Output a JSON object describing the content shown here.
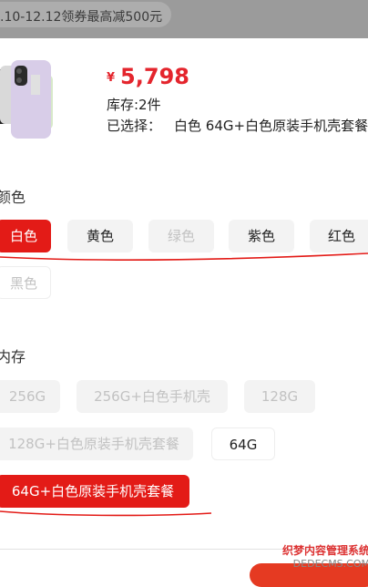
{
  "promo": {
    "text": ".10-12.12领券最高减500元"
  },
  "product": {
    "currency": "¥",
    "price": "5,798",
    "stock": "库存:2件",
    "selected_label": "已选择：",
    "selected_value": "白色 64G+白色原装手机壳套餐"
  },
  "color_section": {
    "title": "颜色",
    "options": [
      {
        "label": "白色",
        "state": "active"
      },
      {
        "label": "黄色",
        "state": "normal"
      },
      {
        "label": "绿色",
        "state": "disabled"
      },
      {
        "label": "紫色",
        "state": "normal"
      },
      {
        "label": "红色",
        "state": "normal"
      },
      {
        "label": "黑色",
        "state": "disabled"
      }
    ]
  },
  "storage_section": {
    "title": "内存",
    "options": [
      {
        "label": "256G",
        "state": "disabled"
      },
      {
        "label": "256G+白色手机壳",
        "state": "disabled"
      },
      {
        "label": "128G",
        "state": "disabled"
      },
      {
        "label": "128G+白色原装手机壳套餐",
        "state": "disabled"
      },
      {
        "label": "64G",
        "state": "normal"
      },
      {
        "label": "64G+白色原装手机壳套餐",
        "state": "active"
      }
    ]
  },
  "watermark": {
    "line1": "织梦内容管理系统",
    "line2": "DEDECMS.COM"
  },
  "colors": {
    "accent": "#e31b17",
    "price": "#e4252d"
  }
}
